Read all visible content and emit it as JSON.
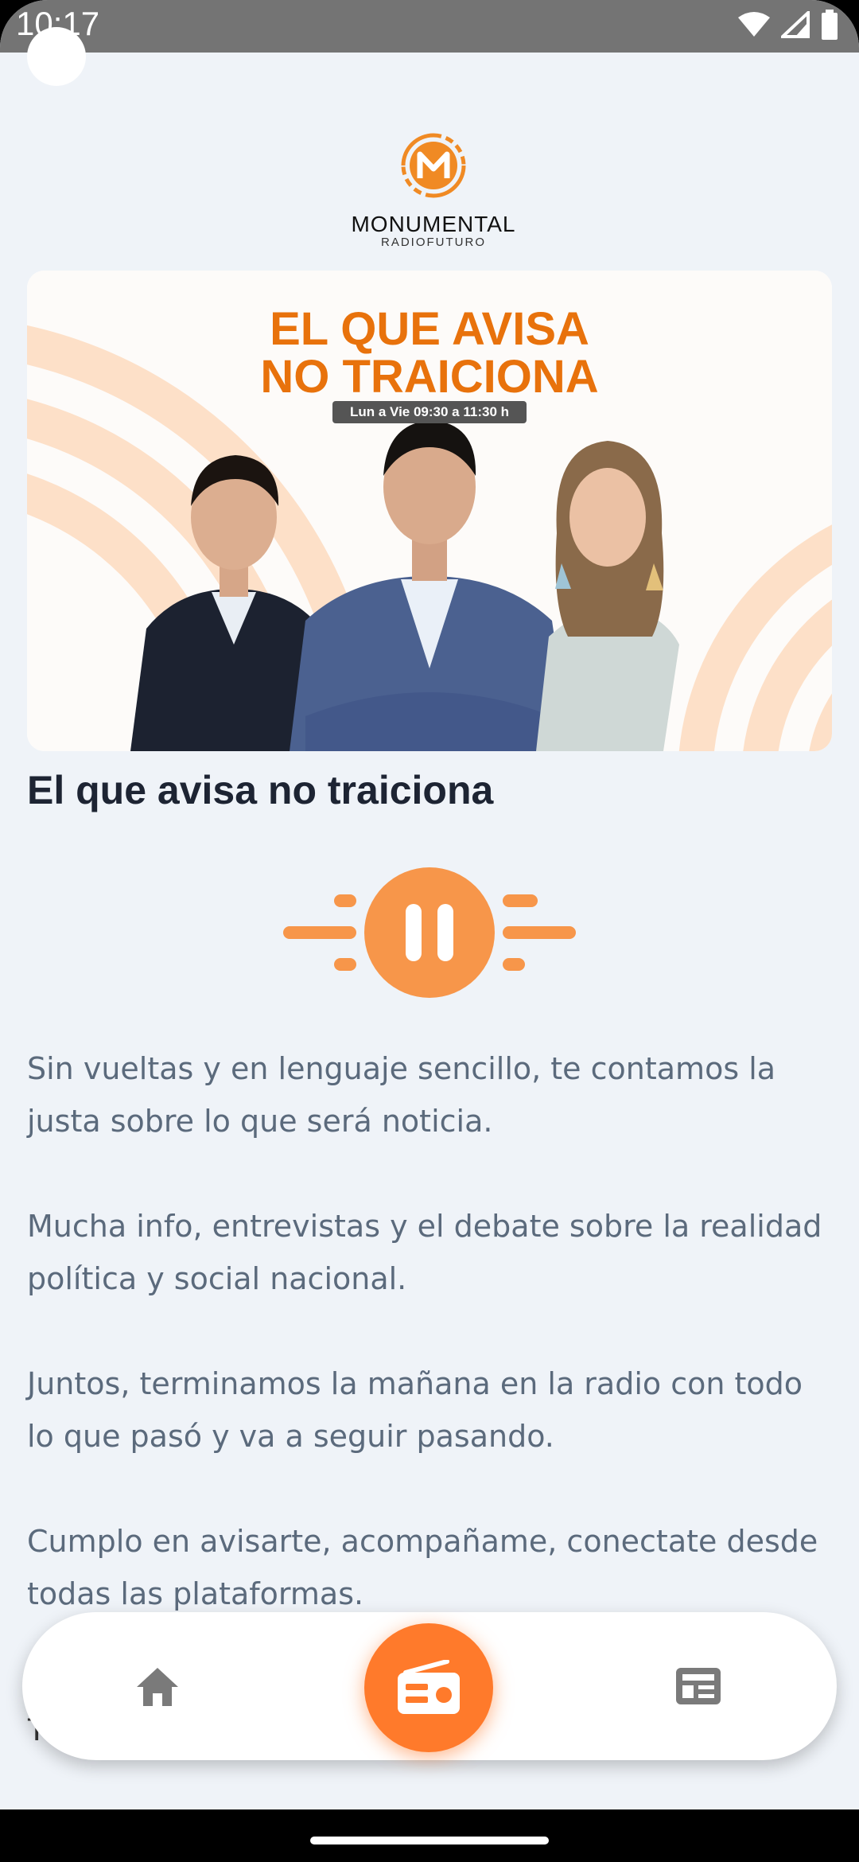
{
  "status_bar": {
    "time": "10:17"
  },
  "logo": {
    "name": "MONUMENTAL",
    "subtitle": "RADIOFUTURO"
  },
  "banner": {
    "title_line1": "EL QUE AVISA",
    "title_line2": "NO TRAICIONA",
    "schedule": "Lun a Vie 09:30 a 11:30 h"
  },
  "program": {
    "title": "El que avisa no traiciona",
    "description": [
      "Sin vueltas y en lenguaje sencillo, te contamos la justa sobre lo que será noticia.",
      "Mucha info, entrevistas y el debate sobre la realidad política y social nacional.",
      "Juntos, terminamos la mañana en la radio con todo lo que pasó y va a seguir pasando.",
      "Cumplo en avisarte, acompañame, conectate desde todas las plataformas."
    ],
    "peek_text": "To"
  },
  "player": {
    "state": "playing",
    "accent": "#f7964a"
  },
  "nav": {
    "items": [
      "home-icon",
      "radio-icon",
      "news-icon"
    ],
    "active": "radio-icon",
    "accent": "#ff7a2b"
  }
}
